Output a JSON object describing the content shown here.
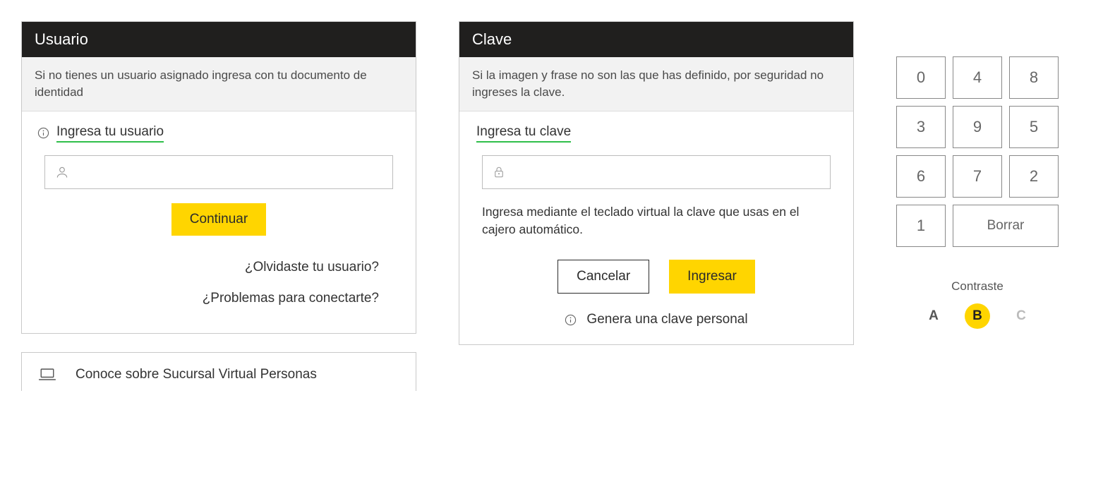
{
  "usuario": {
    "header": "Usuario",
    "hint": "Si no tienes un usuario asignado ingresa con tu documento de identidad",
    "field_label": "Ingresa tu usuario",
    "input_value": "",
    "continue_label": "Continuar",
    "forgot_link": "¿Olvidaste tu usuario?",
    "problems_link": "¿Problemas para conectarte?"
  },
  "info_panel": {
    "text": "Conoce sobre Sucursal Virtual Personas"
  },
  "clave": {
    "header": "Clave",
    "hint": "Si la imagen y frase no son las que has definido, por seguridad no ingreses la clave.",
    "field_label": "Ingresa tu clave",
    "input_value": "",
    "help_below": "Ingresa mediante el teclado virtual la clave que usas en el cajero automático.",
    "cancel_label": "Cancelar",
    "submit_label": "Ingresar",
    "generate_link": "Genera una clave personal"
  },
  "keypad": {
    "keys": [
      "0",
      "4",
      "8",
      "3",
      "9",
      "5",
      "6",
      "7",
      "2",
      "1"
    ],
    "clear_label": "Borrar"
  },
  "contrast": {
    "title": "Contraste",
    "options": [
      "A",
      "B",
      "C"
    ],
    "active": "B"
  }
}
